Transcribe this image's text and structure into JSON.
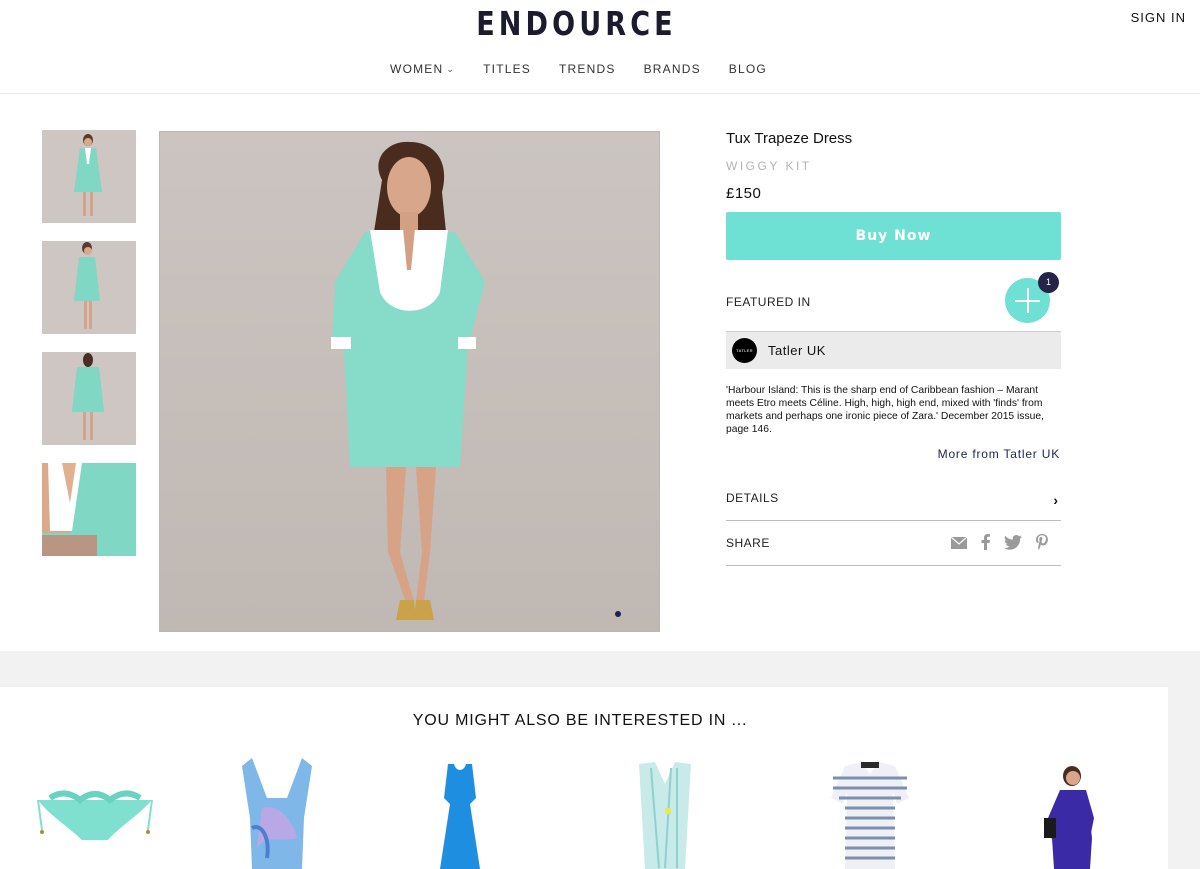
{
  "header": {
    "logo": "ENDOURCE",
    "sign_in": "SIGN IN",
    "nav": [
      {
        "label": "WOMEN",
        "has_dropdown": true,
        "icon": "chevron-down-icon"
      },
      {
        "label": "TITLES"
      },
      {
        "label": "TRENDS"
      },
      {
        "label": "BRANDS"
      },
      {
        "label": "BLOG"
      }
    ]
  },
  "gallery": {
    "thumbnail_count": 4,
    "carousel_active_index": 1
  },
  "product": {
    "title": "Tux Trapeze Dress",
    "brand": "WIGGY KIT",
    "price": "£150",
    "buy_label": "Buy Now"
  },
  "featured": {
    "label": "FEATURED IN",
    "count": "1",
    "publication": "Tatler UK",
    "publication_logo_text": "TATLER",
    "quote": "'Harbour Island: This is the sharp end of Caribbean fashion – Marant meets Etro meets Céline. High, high, high end, mixed with 'finds' from markets and perhaps one ironic piece of Zara.' December 2015 issue, page 146.",
    "more_link": "More from Tatler UK"
  },
  "details": {
    "label": "DETAILS"
  },
  "share": {
    "label": "SHARE",
    "icons": [
      "email-icon",
      "facebook-icon",
      "twitter-icon",
      "pinterest-icon"
    ]
  },
  "recommendations": {
    "title": "YOU MIGHT ALSO BE INTERESTED IN ...",
    "items": [
      {
        "name": "mint-ruffle-bikini-bottom"
      },
      {
        "name": "blue-print-halter-swimsuit"
      },
      {
        "name": "blue-maxi-dress"
      },
      {
        "name": "mint-striped-kaftan"
      },
      {
        "name": "navy-striped-tshirt-dress"
      },
      {
        "name": "purple-dress-model"
      }
    ]
  },
  "colors": {
    "accent": "#6fe0d4",
    "dark_navy": "#232448",
    "link": "#1d2254"
  }
}
